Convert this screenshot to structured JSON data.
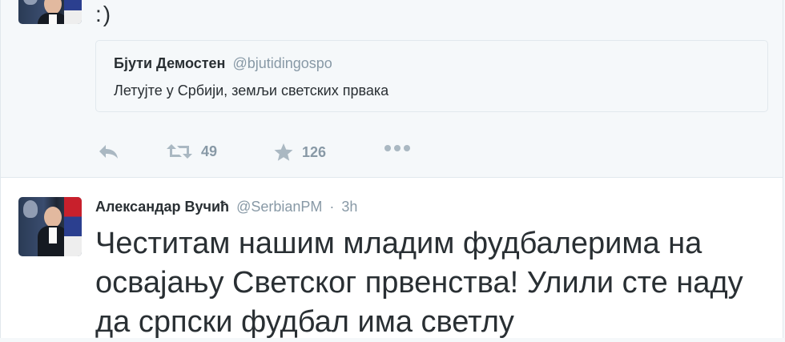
{
  "tweet1": {
    "text": ":)",
    "quote": {
      "name": "Бјути Демостен",
      "handle": "@bjutidingospo",
      "text": "Летујте у Србији, земљи светских првака"
    },
    "actions": {
      "retweets": "49",
      "favorites": "126"
    }
  },
  "tweet2": {
    "name": "Александар Вучић",
    "handle": "@SerbianPM",
    "separator": "·",
    "time": "3h",
    "text": "Честитам нашим младим фудбалерима на освајању Светског првенства! Улили сте наду да српски фудбал има светлу"
  },
  "icons": {
    "reply": "reply-icon",
    "retweet": "retweet-icon",
    "favorite": "star-icon",
    "more": "more-icon"
  },
  "colors": {
    "icon_gray": "#aab8c2",
    "count_gray": "#8899a6",
    "text": "#292f33",
    "bg": "#f5f8fa"
  }
}
